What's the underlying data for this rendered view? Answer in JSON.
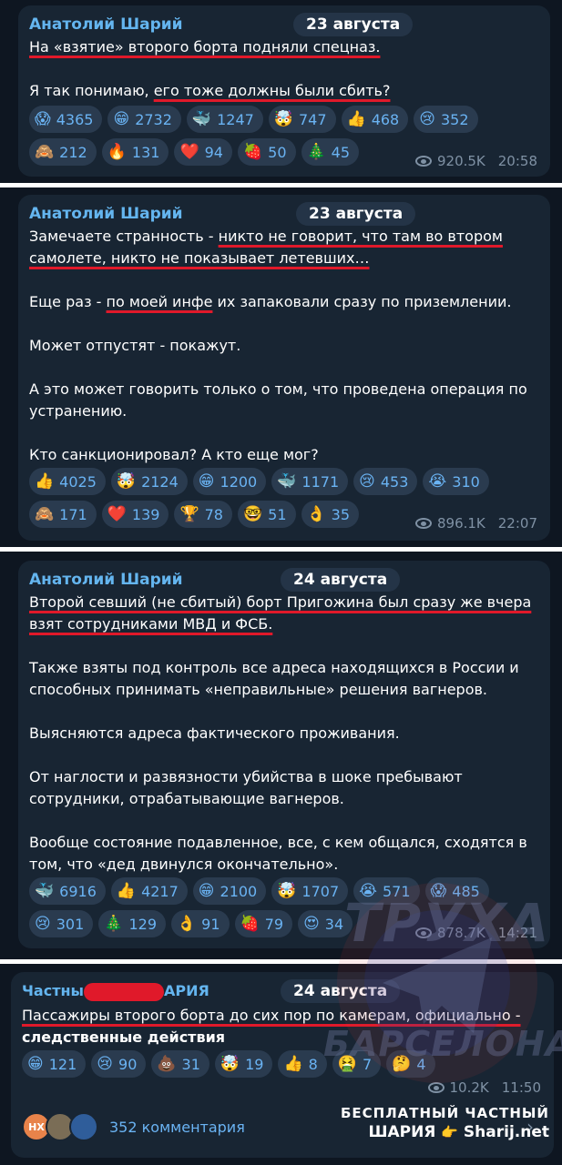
{
  "posts": [
    {
      "author": "Анатолий Шарий",
      "date": "23 августа",
      "lines": [
        {
          "segments": [
            {
              "t": "На «взятие» второго борта подняли спецназ.",
              "u": true
            }
          ]
        },
        {
          "blank": true
        },
        {
          "segments": [
            {
              "t": "Я так понимаю, ",
              "u": false
            },
            {
              "t": "его тоже должны были сбить?",
              "u": true
            }
          ]
        }
      ],
      "reactions": [
        {
          "emoji": "😱",
          "count": "4365"
        },
        {
          "emoji": "😁",
          "count": "2732"
        },
        {
          "emoji": "🐳",
          "count": "1247"
        },
        {
          "emoji": "🤯",
          "count": "747"
        },
        {
          "emoji": "👍",
          "count": "468"
        },
        {
          "emoji": "😢",
          "count": "352"
        },
        {
          "emoji": "🙈",
          "count": "212"
        },
        {
          "emoji": "🔥",
          "count": "131"
        },
        {
          "emoji": "❤️",
          "count": "94"
        },
        {
          "emoji": "🍓",
          "count": "50"
        },
        {
          "emoji": "🎄",
          "count": "45"
        }
      ],
      "views": "920.5K",
      "time": "20:58"
    },
    {
      "author": "Анатолий Шарий",
      "date": "23 августа",
      "lines": [
        {
          "segments": [
            {
              "t": "Замечаете странность - ",
              "u": false
            },
            {
              "t": "никто не говорит, что там во втором",
              "u": true
            }
          ]
        },
        {
          "segments": [
            {
              "t": "самолете, никто не показывает летевших…",
              "u": true
            }
          ]
        },
        {
          "blank": true
        },
        {
          "segments": [
            {
              "t": "Еще раз - ",
              "u": false
            },
            {
              "t": "по моей инфе",
              "u": true
            },
            {
              "t": " их запаковали сразу по приземлении.",
              "u": false
            }
          ]
        },
        {
          "blank": true
        },
        {
          "segments": [
            {
              "t": "Может отпустят - покажут.",
              "u": false
            }
          ]
        },
        {
          "blank": true
        },
        {
          "segments": [
            {
              "t": "А это может говорить только о том, что проведена операция по",
              "u": false
            }
          ]
        },
        {
          "segments": [
            {
              "t": "устранению.",
              "u": false
            }
          ]
        },
        {
          "blank": true
        },
        {
          "segments": [
            {
              "t": "Кто санкционировал? А кто еще мог?",
              "u": false
            }
          ]
        }
      ],
      "reactions": [
        {
          "emoji": "👍",
          "count": "4025"
        },
        {
          "emoji": "🤯",
          "count": "2124"
        },
        {
          "emoji": "😁",
          "count": "1200"
        },
        {
          "emoji": "🐳",
          "count": "1171"
        },
        {
          "emoji": "😢",
          "count": "453"
        },
        {
          "emoji": "😭",
          "count": "310"
        },
        {
          "emoji": "🙈",
          "count": "171"
        },
        {
          "emoji": "❤️",
          "count": "139"
        },
        {
          "emoji": "🏆",
          "count": "78"
        },
        {
          "emoji": "🤓",
          "count": "51"
        },
        {
          "emoji": "👌",
          "count": "35"
        }
      ],
      "views": "896.1K",
      "time": "22:07"
    },
    {
      "author": "Анатолий Шарий",
      "date": "24 августа",
      "lines": [
        {
          "segments": [
            {
              "t": "Второй севший (не сбитый) борт Пригожина был сразу же вчера",
              "u": true
            }
          ]
        },
        {
          "segments": [
            {
              "t": "взят сотрудниками МВД и ФСБ.",
              "u": true
            }
          ]
        },
        {
          "blank": true
        },
        {
          "segments": [
            {
              "t": "Также взяты под контроль все адреса находящихся в России и",
              "u": false
            }
          ]
        },
        {
          "segments": [
            {
              "t": "способных принимать «неправильные» решения вагнеров.",
              "u": false
            }
          ]
        },
        {
          "blank": true
        },
        {
          "segments": [
            {
              "t": "Выясняются адреса фактического проживания.",
              "u": false
            }
          ]
        },
        {
          "blank": true
        },
        {
          "segments": [
            {
              "t": "От наглости и развязности убийства в шоке пребывают",
              "u": false
            }
          ]
        },
        {
          "segments": [
            {
              "t": "сотрудники, отрабатывающие вагнеров.",
              "u": false
            }
          ]
        },
        {
          "blank": true
        },
        {
          "segments": [
            {
              "t": "Вообще состояние подавленное, все, с кем общался, сходятся в",
              "u": false
            }
          ]
        },
        {
          "segments": [
            {
              "t": "том, что «дед двинулся окончательно».",
              "u": false
            }
          ]
        }
      ],
      "reactions": [
        {
          "emoji": "🐳",
          "count": "6916"
        },
        {
          "emoji": "👍",
          "count": "4217"
        },
        {
          "emoji": "😁",
          "count": "2100"
        },
        {
          "emoji": "🤯",
          "count": "1707"
        },
        {
          "emoji": "😭",
          "count": "571"
        },
        {
          "emoji": "😱",
          "count": "485"
        },
        {
          "emoji": "😢",
          "count": "301"
        },
        {
          "emoji": "🎄",
          "count": "129"
        },
        {
          "emoji": "👌",
          "count": "91"
        },
        {
          "emoji": "🍓",
          "count": "79"
        },
        {
          "emoji": "😍",
          "count": "34"
        }
      ],
      "views": "878.7K",
      "time": "14:21"
    },
    {
      "author_start": "Частны",
      "author_end": "АРИЯ",
      "date": "24 августа",
      "lines": [
        {
          "segments": [
            {
              "t": "Пассажиры второго борта до сих пор по камерам, официально -",
              "u": true
            }
          ]
        },
        {
          "segments": [
            {
              "t": "следственные действия",
              "u": false,
              "b": true
            }
          ]
        }
      ],
      "reactions": [
        {
          "emoji": "😁",
          "count": "121"
        },
        {
          "emoji": "😢",
          "count": "90"
        },
        {
          "emoji": "💩",
          "count": "31"
        },
        {
          "emoji": "🤯",
          "count": "19"
        },
        {
          "emoji": "👍",
          "count": "8"
        },
        {
          "emoji": "🤮",
          "count": "7"
        },
        {
          "emoji": "🤔",
          "count": "4"
        }
      ],
      "views": "10.2K",
      "time": "11:50"
    }
  ],
  "comments": {
    "avatar_initials": "НХ",
    "label": "352 комментария"
  },
  "watermark": {
    "line1": "ТРУХА",
    "line2": "БАРСЕЛОНА"
  },
  "credit": {
    "line1": "БЕСПЛАТНЫЙ ЧАСТНЫЙ",
    "line2_a": "ШАРИЯ",
    "line2_b": "Sharij.net"
  },
  "colors": {
    "background": "#0e1621",
    "bubble": "#182533",
    "author": "#64b5ef",
    "underline": "#e0192a"
  }
}
